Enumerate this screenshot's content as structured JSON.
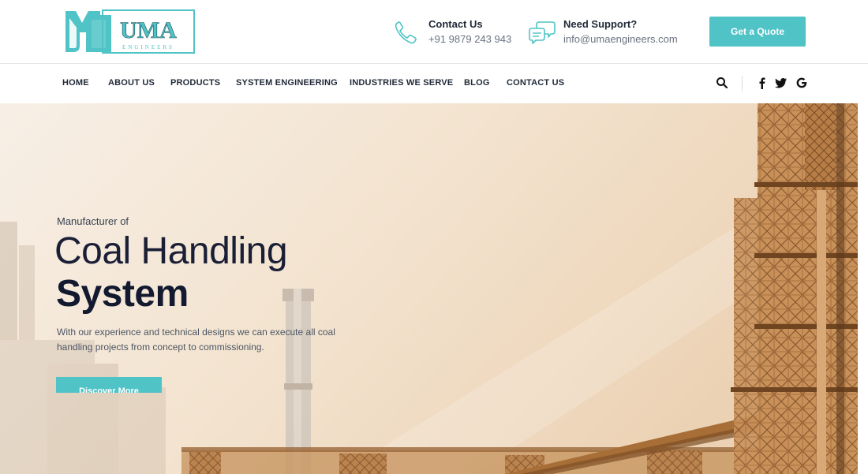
{
  "brand": {
    "logo_text": "UMA",
    "logo_subtext": "ENGINEERS",
    "accent_color": "#4fc3c6"
  },
  "header": {
    "contact": {
      "title": "Contact Us",
      "value": "+91 9879 243 943",
      "icon": "phone-icon"
    },
    "support": {
      "title": "Need Support?",
      "value": "info@umaengineers.com",
      "icon": "chat-bubbles-icon"
    },
    "quote_button": "Get a Quote"
  },
  "nav": {
    "items": [
      {
        "label": "HOME"
      },
      {
        "label": "ABOUT US"
      },
      {
        "label": "PRODUCTS"
      },
      {
        "label": "SYSTEM ENGINEERING"
      },
      {
        "label": "INDUSTRIES WE SERVE"
      },
      {
        "label": "BLOG"
      },
      {
        "label": "CONTACT US"
      }
    ],
    "icons": [
      "search-icon",
      "facebook-icon",
      "twitter-icon",
      "google-icon"
    ]
  },
  "hero": {
    "eyebrow": "Manufacturer of",
    "title_light": "Coal Handling",
    "title_bold": "System",
    "description": "With our experience and technical designs we can execute all coal handling projects from concept to commissioning.",
    "button": "Discover More"
  }
}
